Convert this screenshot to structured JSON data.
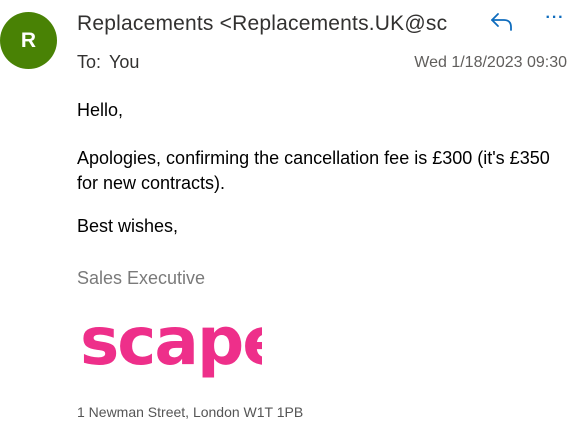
{
  "message": {
    "avatar_initial": "R",
    "sender": "Replacements <Replacements.UK@sc",
    "to_label": "To:",
    "to_value": "You",
    "date": "Wed 1/18/2023 09:30",
    "greeting": "Hello,",
    "body": "Apologies, confirming the cancellation fee is £300 (it's £350 for new contracts).",
    "signoff": "Best wishes,",
    "signature_title": "Sales Executive",
    "logo_text": "scape",
    "address": "1 Newman Street, London W1T 1PB"
  },
  "actions": {
    "reply_icon": "reply-icon",
    "more_icon": "more-options-icon",
    "more_glyph": "···"
  },
  "colors": {
    "avatar_bg": "#498205",
    "accent": "#0f6cbd",
    "logo": "#ee2f8a"
  }
}
